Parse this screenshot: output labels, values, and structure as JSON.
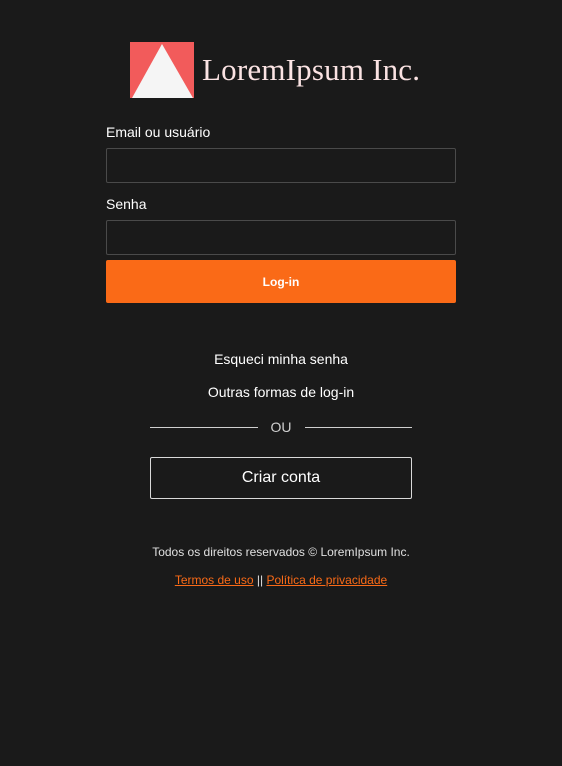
{
  "logo": {
    "text": "LoremIpsum Inc.",
    "icon": "triangle-logo-icon",
    "mark_color": "#f25b5b",
    "triangle_color": "#f5f5f5"
  },
  "login_form": {
    "email_label": "Email ou usuário",
    "email_value": "",
    "password_label": "Senha",
    "password_value": "",
    "submit_label": "Log-in"
  },
  "links": {
    "forgot_password": "Esqueci minha senha",
    "other_login": "Outras formas de log-in"
  },
  "divider": {
    "text": "OU"
  },
  "create_account": {
    "label": "Criar conta"
  },
  "footer": {
    "copyright": "Todos os direitos reservados © LoremIpsum Inc.",
    "terms": "Termos de uso",
    "separator": "||",
    "privacy": "Política de privacidade"
  },
  "colors": {
    "background": "#1a1a1a",
    "accent": "#fa6a17",
    "text": "#ffffff"
  }
}
